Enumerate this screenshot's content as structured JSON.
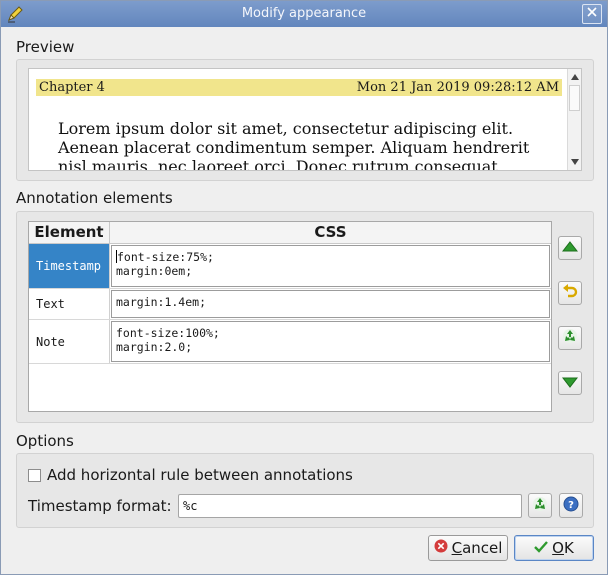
{
  "window": {
    "title": "Modify appearance"
  },
  "preview": {
    "label": "Preview",
    "chapter": "Chapter 4",
    "timestamp": "Mon 21 Jan 2019 09:28:12 AM",
    "text_line1": "Lorem ipsum dolor sit amet, consectetur adipiscing elit.",
    "text_line2": "Aenean placerat condimentum semper. Aliquam hendrerit",
    "text_line3": "nisl mauris, nec laoreet orci. Donec rutrum consequat"
  },
  "annotations": {
    "label": "Annotation elements",
    "col_element": "Element",
    "col_css": "CSS",
    "rows": [
      {
        "element": "Timestamp",
        "css_line1": "font-size:75%;",
        "css_line2": "margin:0em;"
      },
      {
        "element": "Text",
        "css_line1": "margin:1.4em;",
        "css_line2": ""
      },
      {
        "element": "Note",
        "css_line1": "font-size:100%;",
        "css_line2": "margin:2.0;"
      }
    ]
  },
  "options": {
    "label": "Options",
    "hr_checkbox_label": "Add horizontal rule between annotations",
    "hr_checked": false,
    "timestamp_format_label": "Timestamp format:",
    "timestamp_format_value": "%c"
  },
  "buttons": {
    "cancel_first": "C",
    "cancel_rest": "ancel",
    "ok_first": "O",
    "ok_rest": "K"
  },
  "icons": {
    "title_icon": "pencil-icon",
    "close": "close-icon",
    "move_up": "arrow-up-icon",
    "undo": "undo-icon",
    "reset": "recycle-icon",
    "move_down": "arrow-down-icon",
    "help": "help-icon",
    "cancel": "cancel-icon",
    "ok": "checkmark-icon"
  },
  "colors": {
    "titlebar": "#6f8fc4",
    "selection": "#3584c7",
    "preview_header": "#f1e58c",
    "green_arrow": "#2f9a2f"
  }
}
